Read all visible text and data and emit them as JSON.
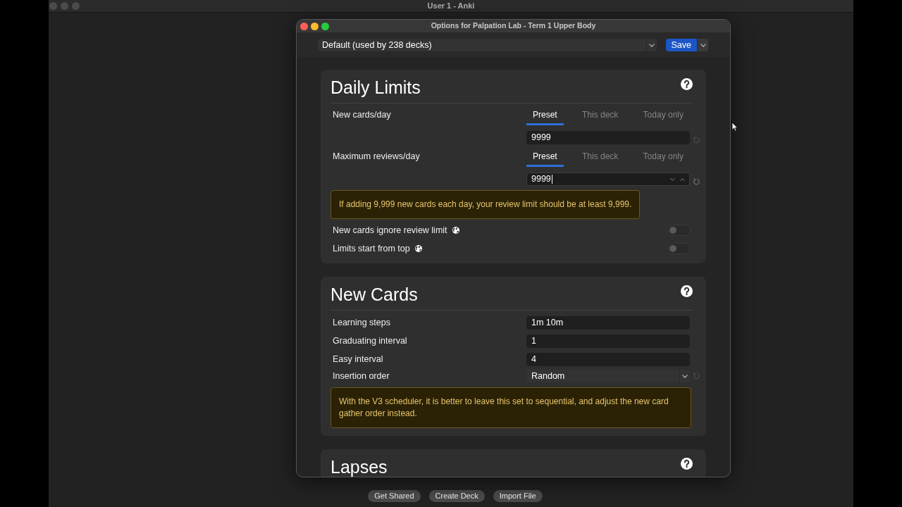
{
  "main_window": {
    "title": "User 1 - Anki",
    "active": false,
    "buttons": [
      "Get Shared",
      "Create Deck",
      "Import File"
    ]
  },
  "dialog": {
    "title": "Options for Palpation Lab - Term 1 Upper Body",
    "active": true,
    "preset": "Default (used by 238 decks)",
    "save_button": "Save",
    "sections": [
      {
        "title": "Daily Limits",
        "rows": [
          {
            "kind": "tabbed_number",
            "label": "New cards/day",
            "tabs": [
              {
                "label": "Preset",
                "selected": true
              },
              {
                "label": "This deck",
                "selected": false
              },
              {
                "label": "Today only",
                "selected": false
              }
            ],
            "value": "9999",
            "focused": false,
            "revert": true
          },
          {
            "kind": "tabbed_number",
            "label": "Maximum reviews/day",
            "tabs": [
              {
                "label": "Preset",
                "selected": true
              },
              {
                "label": "This deck",
                "selected": false
              },
              {
                "label": "Today only",
                "selected": false
              }
            ],
            "value": "9999",
            "focused": true,
            "revert": true
          },
          {
            "kind": "warning",
            "text": "If adding 9,999 new cards each day, your review limit should be at least 9,999."
          },
          {
            "kind": "toggle",
            "label": "New cards ignore review limit",
            "global": true,
            "on": false
          },
          {
            "kind": "toggle",
            "label": "Limits start from top",
            "global": true,
            "on": false
          }
        ]
      },
      {
        "title": "New Cards",
        "rows": [
          {
            "kind": "input",
            "label": "Learning steps",
            "value": "1m 10m",
            "revert": false
          },
          {
            "kind": "input",
            "label": "Graduating interval",
            "value": "1",
            "revert": false
          },
          {
            "kind": "input",
            "label": "Easy interval",
            "value": "4",
            "revert": false
          },
          {
            "kind": "select",
            "label": "Insertion order",
            "value": "Random",
            "revert": true
          },
          {
            "kind": "warning",
            "text": "With the V3 scheduler, it is better to leave this set to sequential, and adjust the new card gather order instead."
          }
        ]
      },
      {
        "title": "Lapses"
      }
    ]
  }
}
